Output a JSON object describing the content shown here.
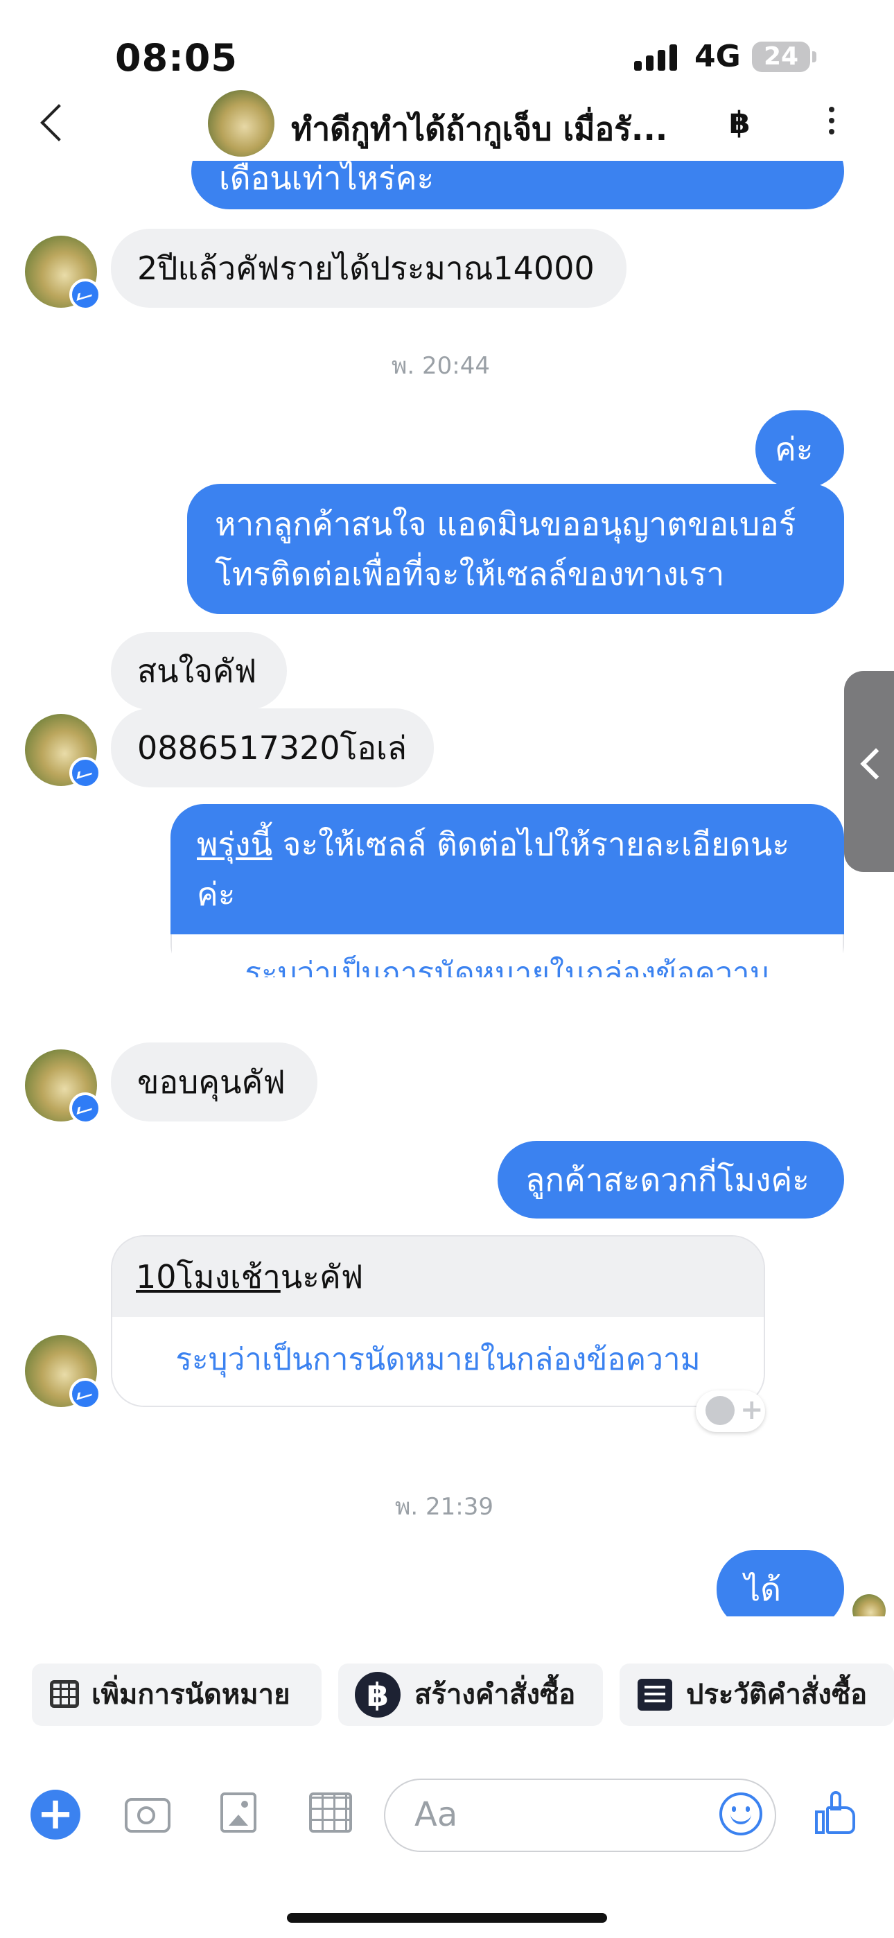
{
  "status_bar": {
    "time": "08:05",
    "network": "4G",
    "battery": "24"
  },
  "header": {
    "title": "ทำดีกูทำได้ถ้ากูเจ็บ เมื่อรั...",
    "baht_icon": "฿",
    "back_icon": "chevron-left-icon",
    "more_icon": "more-vertical-icon"
  },
  "messages": {
    "top_partial": "เดือนเท่าไหร่คะ",
    "in_1": "2ปีแล้วคัฟรายได้ประมาณ14000",
    "time_1": "พ. 20:44",
    "out_1": "ค่ะ",
    "out_2_line1": "หากลูกค้าสนใจ แอดมินขออนุญาตขอเบอร์",
    "out_2_line2": "โทรติดต่อเพื่อที่จะให้เซลล์ของทางเรา",
    "in_2": "สนใจคัฟ",
    "in_3": "0886517320โอเล่",
    "out_3_link": "พรุ่งนี้",
    "out_3_rest": " จะให้เซลล์ ติดต่อไปให้รายละเอียดนะ",
    "out_3_line2": "ค่ะ",
    "out_3_action": "ระบุว่าเป็นการนัดหมายในกล่องข้อความ",
    "in_4": "ขอบคุนคัฟ",
    "out_4": "ลูกค้าสะดวกกี่โมงค่ะ",
    "in_5_link": "10โมงเช้า",
    "in_5_rest": "นะคัฟ",
    "in_5_action": "ระบุว่าเป็นการนัดหมายในกล่องข้อความ",
    "time_2": "พ. 21:39",
    "out_5": "ได้ค่ะ"
  },
  "quick_actions": [
    {
      "label": "เพิ่มการนัดหมาย",
      "icon": "calendar-icon"
    },
    {
      "label": "สร้างคำสั่งซื้อ",
      "icon": "baht-icon",
      "glyph": "฿"
    },
    {
      "label": "ประวัติคำสั่งซื้อ",
      "icon": "list-icon"
    }
  ],
  "composer": {
    "placeholder": "Aa"
  },
  "colors": {
    "accent": "#3b82f0",
    "incoming": "#eff0f2"
  }
}
